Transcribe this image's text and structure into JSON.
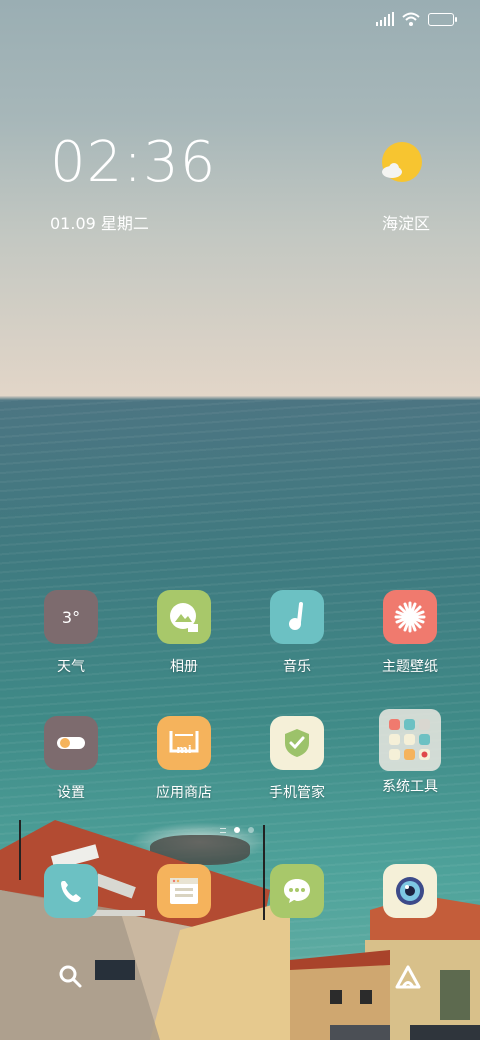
{
  "status_bar": {
    "icons": [
      "signal-icon",
      "wifi-icon",
      "battery-icon"
    ]
  },
  "clock_widget": {
    "time": "02:36",
    "date": "01.09 星期二"
  },
  "weather_widget": {
    "location": "海淀区",
    "icon": "partly-sunny-icon"
  },
  "home_apps": [
    {
      "label": "天气",
      "icon": "weather-icon",
      "tile_text": "3°",
      "color": "#7d6b6e"
    },
    {
      "label": "相册",
      "icon": "gallery-icon",
      "color": "#a8c86a"
    },
    {
      "label": "音乐",
      "icon": "music-icon",
      "color": "#6cc1c3"
    },
    {
      "label": "主题壁纸",
      "icon": "themes-icon",
      "color": "#f07a6e"
    },
    {
      "label": "设置",
      "icon": "settings-icon",
      "color": "#7d6b6e"
    },
    {
      "label": "应用商店",
      "icon": "app-store-icon",
      "tile_text": "mi",
      "color": "#f5b35c"
    },
    {
      "label": "手机管家",
      "icon": "security-icon",
      "color": "#f5f0d8"
    },
    {
      "label": "系统工具",
      "icon": "folder-icon",
      "color": "#d9d7d0"
    }
  ],
  "page_indicator": {
    "pages": 2,
    "current": 1
  },
  "dock": [
    {
      "name": "phone",
      "icon": "phone-icon",
      "color": "#6cc1c3"
    },
    {
      "name": "browser",
      "icon": "browser-icon",
      "color": "#f5b35c"
    },
    {
      "name": "messages",
      "icon": "messages-icon",
      "color": "#a8c86a"
    },
    {
      "name": "camera",
      "icon": "camera-icon",
      "color": "#f5f0d8"
    }
  ],
  "bottom_bar": {
    "left_icon": "search-icon",
    "right_icon": "app-vault-icon"
  }
}
